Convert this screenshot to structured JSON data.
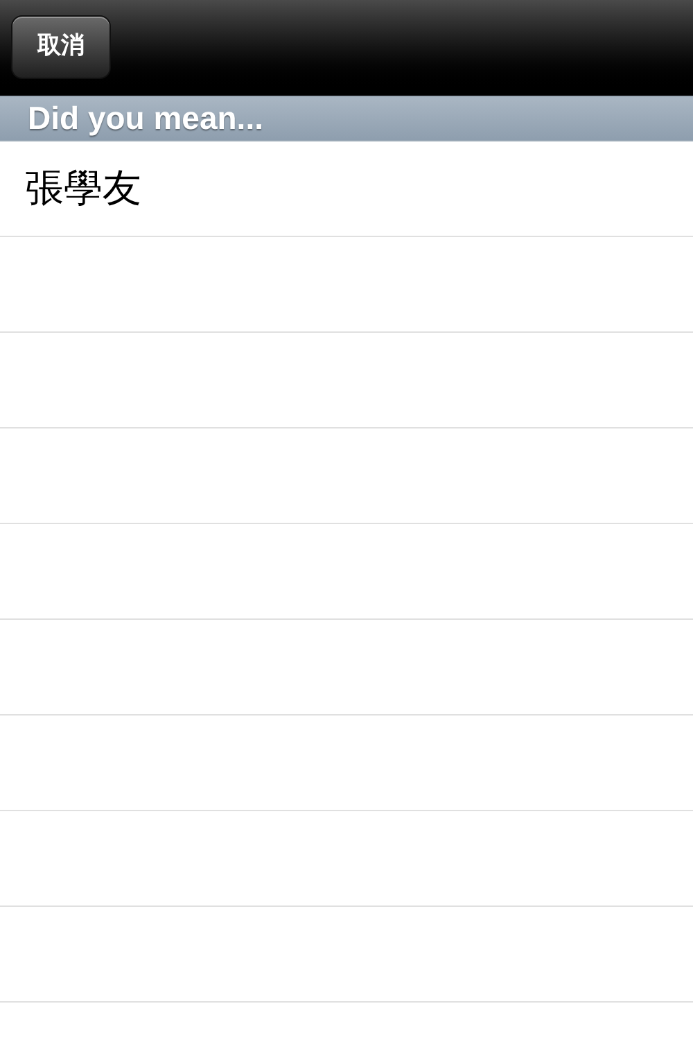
{
  "nav_bar": {
    "cancel_button": "取消"
  },
  "section_header": "Did you mean...",
  "rows": [
    {
      "label": "張學友"
    }
  ]
}
